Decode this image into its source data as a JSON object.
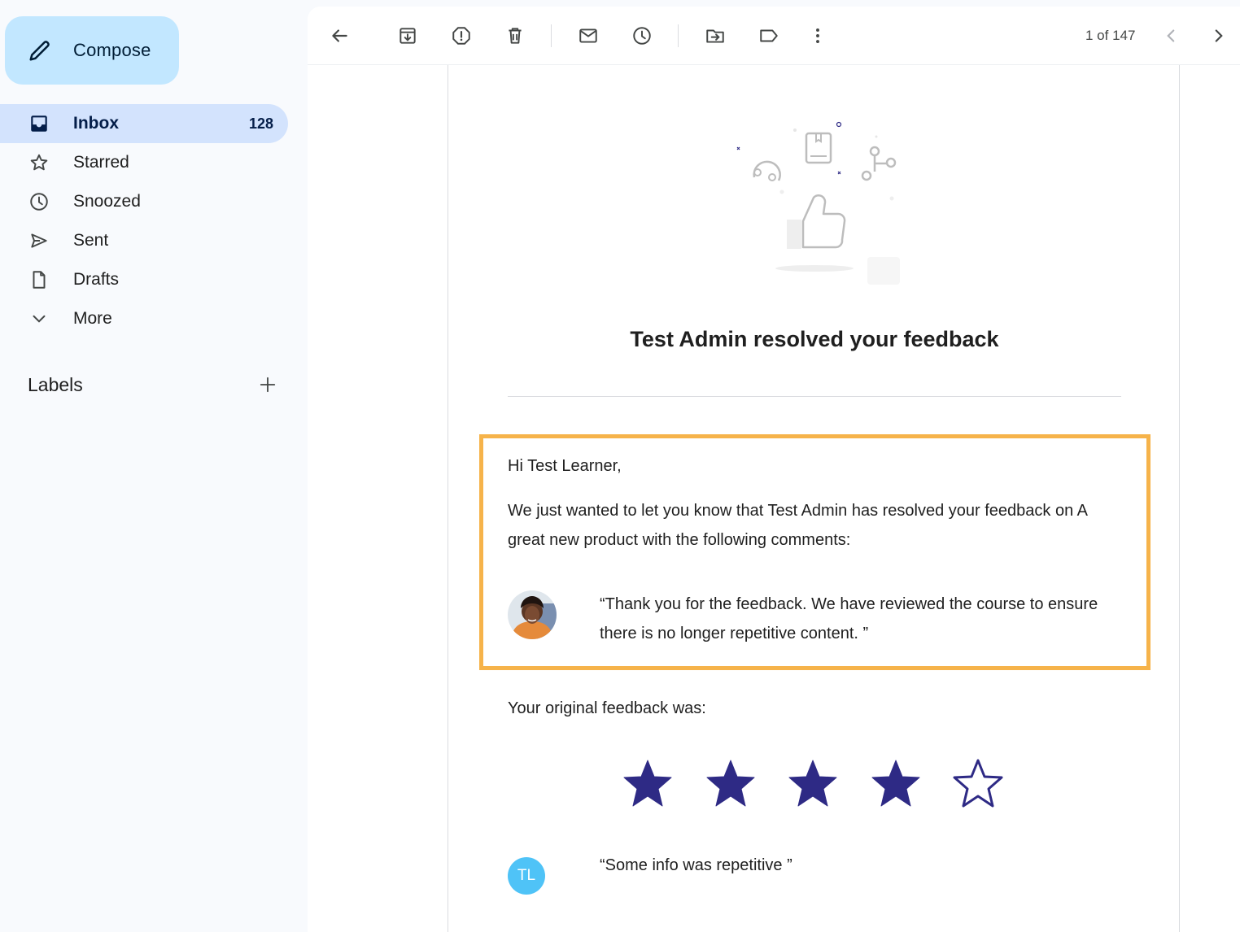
{
  "sidebar": {
    "compose_label": "Compose",
    "items": [
      {
        "label": "Inbox",
        "count": "128",
        "icon": "inbox-icon",
        "active": true
      },
      {
        "label": "Starred",
        "icon": "star-icon"
      },
      {
        "label": "Snoozed",
        "icon": "clock-icon"
      },
      {
        "label": "Sent",
        "icon": "send-icon"
      },
      {
        "label": "Drafts",
        "icon": "draft-icon"
      },
      {
        "label": "More",
        "icon": "chevron-down-icon"
      }
    ],
    "labels_title": "Labels"
  },
  "toolbar": {
    "icons": [
      "back-arrow-icon",
      "archive-icon",
      "report-spam-icon",
      "delete-icon",
      "mark-unread-icon",
      "snooze-icon",
      "move-to-icon",
      "label-icon",
      "more-vert-icon",
      "chevron-left-icon",
      "chevron-right-icon"
    ],
    "pager": "1 of 147"
  },
  "email": {
    "title": "Test Admin resolved your feedback",
    "greeting": "Hi Test Learner,",
    "body": "We just wanted to let you know that Test Admin has resolved your feedback on A great new product with the following comments:",
    "reply_quote": "“Thank you for the feedback. We have reviewed the course to ensure there is no longer repetitive content. ”",
    "original_label": "Your original feedback was:",
    "rating": 4,
    "rating_max": 5,
    "star_color": "#2e2a85",
    "highlight_color": "#f6b34a",
    "learner_initials": "TL",
    "original_quote": "“Some info was repetitive ”"
  }
}
